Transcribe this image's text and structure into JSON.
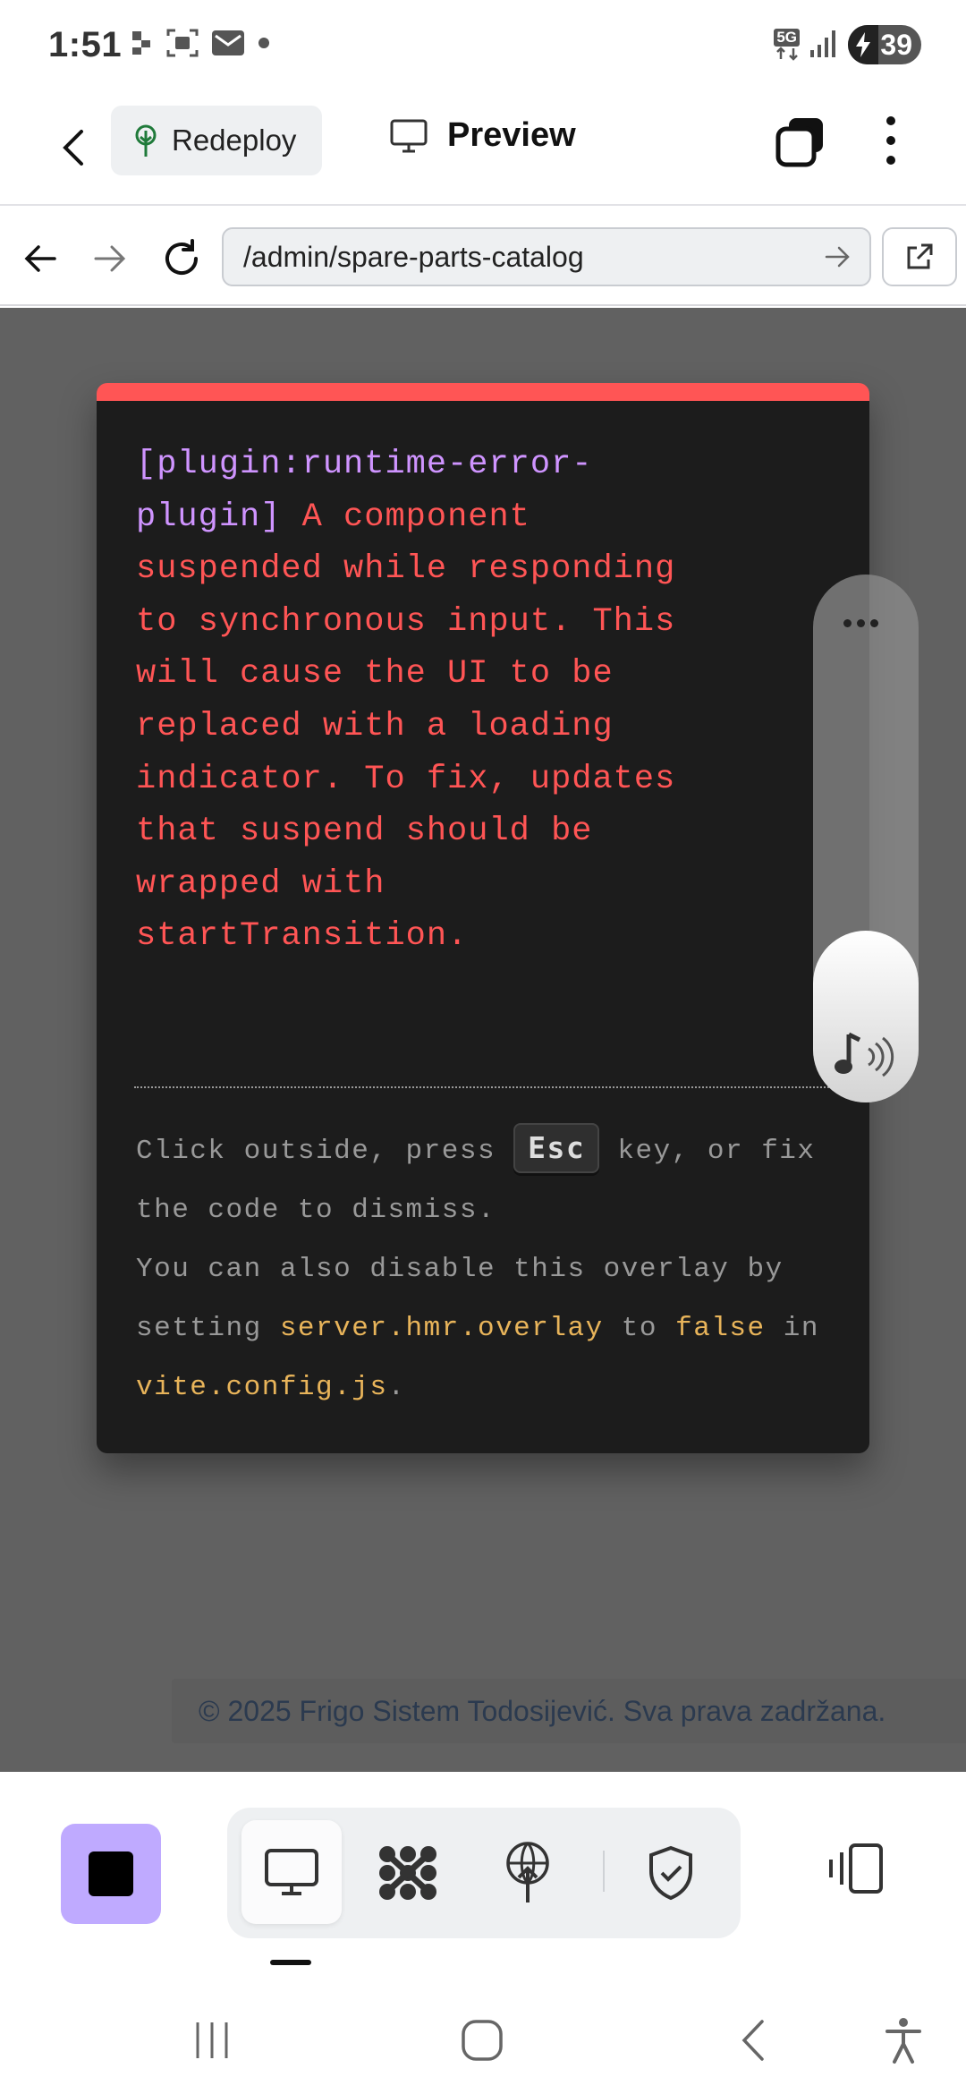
{
  "status_bar": {
    "time": "1:51",
    "network": "5G",
    "battery_level": "39",
    "left_icons": [
      "dots-icon",
      "screenshot-icon",
      "mail-icon",
      "dot-icon"
    ],
    "right_icons": [
      "5g-icon",
      "signal-icon",
      "battery-charging-icon"
    ]
  },
  "app_header": {
    "back_icon": "chevron-left-icon",
    "redeploy_label": "Redeploy",
    "redeploy_icon": "tree-icon",
    "title": "Preview",
    "title_icon": "monitor-icon",
    "tabs_icon": "tabs-icon",
    "more_icon": "more-vertical-icon"
  },
  "url_bar": {
    "url": "/admin/spare-parts-catalog",
    "back_icon": "arrow-left-icon",
    "forward_icon": "arrow-right-icon",
    "reload_icon": "reload-icon",
    "go_icon": "arrow-right-icon",
    "external_icon": "external-link-icon"
  },
  "error_overlay": {
    "accent_color": "#ff5555",
    "plugin_tag": "[plugin:runtime-error-\nplugin]",
    "message": " A component\nsuspended while responding\nto synchronous input. This\nwill cause the UI to be\nreplaced with a loading\nindicator. To fix, updates\nthat suspend should be\nwrapped with\nstartTransition.",
    "tip_prefix": "Click outside, press ",
    "tip_key": "Esc",
    "tip_middle": " key, or fix the code to dismiss.",
    "tip_line2_prefix": "You can also disable this overlay by setting ",
    "tip_setting": "server.hmr.overlay",
    "tip_to": " to ",
    "tip_false": "false",
    "tip_in": " in ",
    "tip_file": "vite.config.js",
    "tip_end": "."
  },
  "floating_control": {
    "menu_icon": "more-horizontal-icon",
    "sound_icon": "music-sound-icon"
  },
  "page_footer": {
    "text": "© 2025 Frigo Sistem Todosijević. Sva prava zadržana."
  },
  "bottom_toolbar": {
    "accent_color": "#bfaaff",
    "stop_icon": "stop-icon",
    "segments": [
      {
        "icon": "monitor-icon",
        "active": true
      },
      {
        "icon": "nodes-icon",
        "active": false
      },
      {
        "icon": "deploy-icon",
        "active": false
      },
      {
        "icon": "shield-check-icon",
        "active": false
      }
    ],
    "side_icon": "panel-toggle-icon"
  },
  "system_nav": {
    "icons": [
      "recents-icon",
      "home-icon",
      "back-icon",
      "accessibility-icon"
    ]
  }
}
